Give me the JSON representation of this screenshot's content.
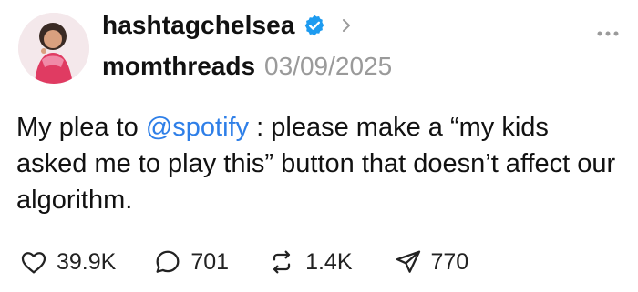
{
  "header": {
    "username": "hashtagchelsea",
    "thread_name": "momthreads",
    "date": "03/09/2025",
    "verified_icon": "verified-badge-icon",
    "chevron_icon": "chevron-right-icon",
    "more_icon": "more-dots-icon"
  },
  "post": {
    "text_before": "My plea to ",
    "mention": "@spotify",
    "text_after": " : please make a “my kids asked me to play this” button that doesn’t affect our algorithm."
  },
  "actions": {
    "likes": "39.9K",
    "replies": "701",
    "reposts": "1.4K",
    "shares": "770",
    "like_icon": "heart-icon",
    "reply_icon": "comment-icon",
    "repost_icon": "repost-icon",
    "share_icon": "send-icon"
  },
  "colors": {
    "verified": "#1d9bf0",
    "mention": "#2e7fe8",
    "date": "#9a9a9a"
  }
}
